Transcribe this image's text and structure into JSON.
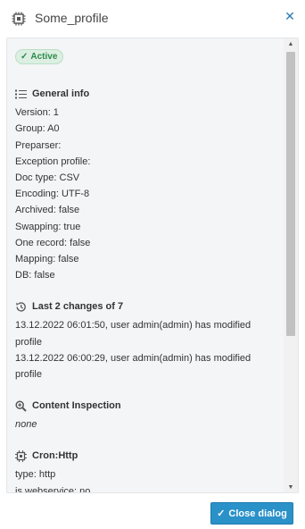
{
  "header": {
    "title": "Some_profile",
    "icon": "chip-icon",
    "close_icon": "close-icon"
  },
  "status": {
    "label": "Active",
    "color": "#2c8a4b"
  },
  "general_info": {
    "title": "General info",
    "items": [
      "Version: 1",
      "Group: A0",
      "Preparser:",
      "Exception profile:",
      "Doc type: CSV",
      "Encoding: UTF-8",
      "Archived: false",
      "Swapping: true",
      "One record: false",
      "Mapping: false",
      "DB: false"
    ]
  },
  "changes": {
    "title": "Last 2 changes of 7",
    "items": [
      "13.12.2022 06:01:50, user admin(admin) has modified profile",
      "13.12.2022 06:00:29, user admin(admin) has modified profile"
    ]
  },
  "content_inspection": {
    "title": "Content Inspection",
    "value": "none"
  },
  "cron": {
    "title": "Cron:Http",
    "items": [
      "type: http",
      "is webservice: no"
    ]
  },
  "footer": {
    "close_label": "Close dialog"
  },
  "colors": {
    "accent": "#2a91c9",
    "active_bg": "#dcefe2"
  }
}
